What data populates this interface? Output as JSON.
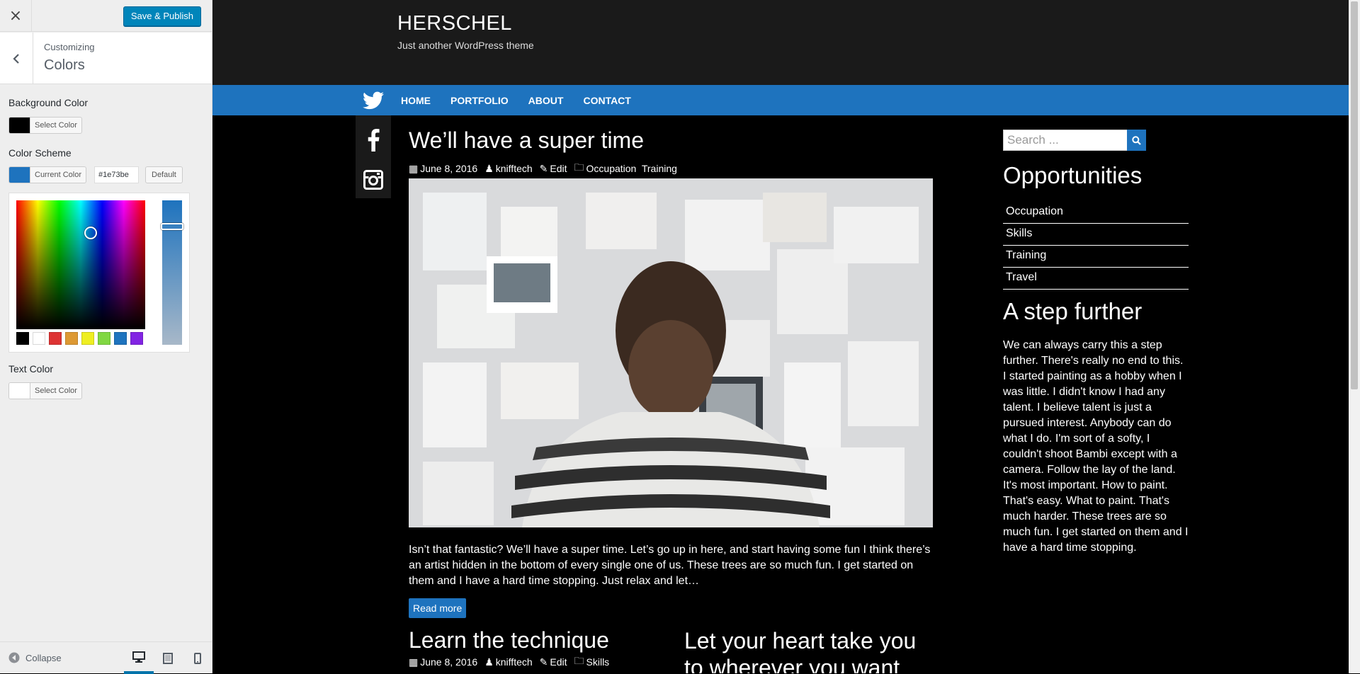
{
  "customizer": {
    "close_label": "×",
    "publish_label": "Save & Publish",
    "customizing_label": "Customizing",
    "section_name": "Colors",
    "background_color": {
      "label": "Background Color",
      "button_label": "Select Color",
      "swatch": "#000000"
    },
    "color_scheme": {
      "label": "Color Scheme",
      "button_label": "Current Color",
      "swatch": "#1e73be",
      "hex_value": "#1e73be",
      "default_label": "Default"
    },
    "palette": [
      "#000000",
      "#ffffff",
      "#dd3333",
      "#dd9933",
      "#eeee22",
      "#81d742",
      "#1e73be",
      "#8224e3"
    ],
    "text_color": {
      "label": "Text Color",
      "button_label": "Select Color",
      "swatch": "#ffffff"
    },
    "collapse_label": "Collapse"
  },
  "site": {
    "title": "HERSCHEL",
    "tagline": "Just another WordPress theme",
    "accent": "#1e73be",
    "nav": [
      "HOME",
      "PORTFOLIO",
      "ABOUT",
      "CONTACT"
    ],
    "social_icons": [
      "twitter-icon",
      "facebook-icon",
      "instagram-icon"
    ]
  },
  "posts": [
    {
      "title": "We’ll have a super time",
      "date": "June 8, 2016",
      "author": "knifftech",
      "edit": "Edit",
      "categories": "Occupation  Training",
      "excerpt": "Isn’t that fantastic? We’ll have a super time. Let’s go up in here, and start having some fun I think there’s an artist hidden in the bottom of every single one of us. These trees are so much fun. I get started on them and I have a hard time stopping. Just relax and let…",
      "read_more": "Read more"
    },
    {
      "title": "Learn the technique",
      "date": "June 8, 2016",
      "author": "knifftech",
      "edit": "Edit",
      "categories": "Skills"
    },
    {
      "title": "Let your heart take you to wherever you want"
    }
  ],
  "sidebar": {
    "search_placeholder": "Search ...",
    "widget1_title": "Opportunities",
    "widget1_items": [
      "Occupation",
      "Skills",
      "Training",
      "Travel"
    ],
    "widget2_title": "A step further",
    "widget2_text": "We can always carry this a step further. There's really no end to this. I started painting as a hobby when I was little. I didn't know I had any talent. I believe talent is just a pursued interest. Anybody can do what I do. I'm sort of a softy, I couldn't shoot Bambi except with a camera. Follow the lay of the land. It's most important. How to paint. That's easy. What to paint. That's much harder. These trees are so much fun. I get started on them and I have a hard time stopping."
  }
}
